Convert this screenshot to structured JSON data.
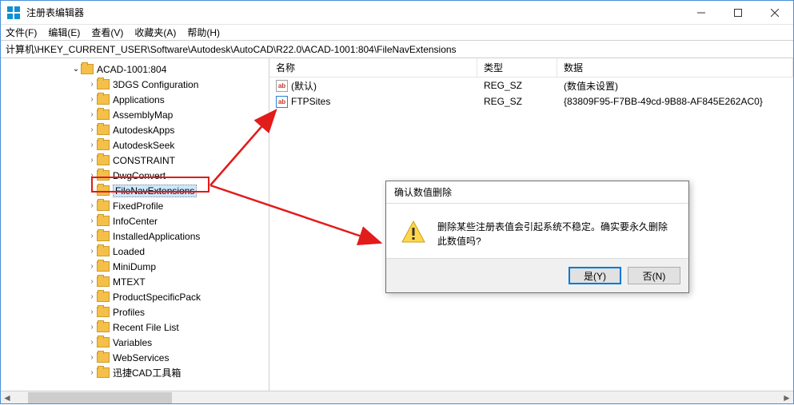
{
  "window": {
    "title": "注册表编辑器"
  },
  "menu": {
    "file": "文件(F)",
    "edit": "编辑(E)",
    "view": "查看(V)",
    "favorites": "收藏夹(A)",
    "help": "帮助(H)"
  },
  "address": "计算机\\HKEY_CURRENT_USER\\Software\\Autodesk\\AutoCAD\\R22.0\\ACAD-1001:804\\FileNavExtensions",
  "tree": {
    "parent": "ACAD-1001:804",
    "items": [
      "3DGS Configuration",
      "Applications",
      "AssemblyMap",
      "AutodeskApps",
      "AutodeskSeek",
      "CONSTRAINT",
      "DwgConvert",
      "FileNavExtensions",
      "FixedProfile",
      "InfoCenter",
      "InstalledApplications",
      "Loaded",
      "MiniDump",
      "MTEXT",
      "ProductSpecificPack",
      "Profiles",
      "Recent File List",
      "Variables",
      "WebServices",
      "迅捷CAD工具箱"
    ],
    "selected": "FileNavExtensions"
  },
  "list": {
    "headers": {
      "name": "名称",
      "type": "类型",
      "data": "数据"
    },
    "rows": [
      {
        "name": "(默认)",
        "type": "REG_SZ",
        "data": "(数值未设置)"
      },
      {
        "name": "FTPSites",
        "type": "REG_SZ",
        "data": "{83809F95-F7BB-49cd-9B88-AF845E262AC0}"
      }
    ]
  },
  "dialog": {
    "title": "确认数值删除",
    "message": "删除某些注册表值会引起系统不稳定。确实要永久删除此数值吗?",
    "yes": "是(Y)",
    "no": "否(N)"
  }
}
